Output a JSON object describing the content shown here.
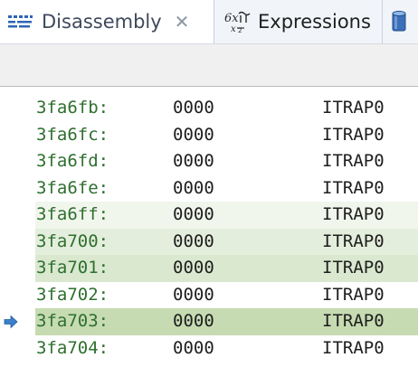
{
  "tabs": [
    {
      "label": "Disassembly",
      "close_symbol": "✕",
      "icon": "disassembly-icon",
      "active": true
    },
    {
      "label": "Expressions",
      "icon": "expressions-icon",
      "active": false
    },
    {
      "icon": "cylinder-icon",
      "active": false
    }
  ],
  "colors": {
    "address": "#2f6f2f",
    "highlight_faint": "#f1f6ed",
    "highlight_light": "#e4eedc",
    "highlight_medium": "#d9e8cf",
    "highlight_current": "#c6dbb1",
    "pc_marker": "#3a7fc9"
  },
  "disassembly": {
    "rows": [
      {
        "address": "3fa6fb:",
        "opcode": "0000",
        "mnemonic": "ITRAP0",
        "highlight": "none",
        "current": false
      },
      {
        "address": "3fa6fc:",
        "opcode": "0000",
        "mnemonic": "ITRAP0",
        "highlight": "none",
        "current": false
      },
      {
        "address": "3fa6fd:",
        "opcode": "0000",
        "mnemonic": "ITRAP0",
        "highlight": "none",
        "current": false
      },
      {
        "address": "3fa6fe:",
        "opcode": "0000",
        "mnemonic": "ITRAP0",
        "highlight": "none",
        "current": false
      },
      {
        "address": "3fa6ff:",
        "opcode": "0000",
        "mnemonic": "ITRAP0",
        "highlight": "faint",
        "current": false
      },
      {
        "address": "3fa700:",
        "opcode": "0000",
        "mnemonic": "ITRAP0",
        "highlight": "light",
        "current": false
      },
      {
        "address": "3fa701:",
        "opcode": "0000",
        "mnemonic": "ITRAP0",
        "highlight": "medium",
        "current": false
      },
      {
        "address": "3fa702:",
        "opcode": "0000",
        "mnemonic": "ITRAP0",
        "highlight": "none",
        "current": false
      },
      {
        "address": "3fa703:",
        "opcode": "0000",
        "mnemonic": "ITRAP0",
        "highlight": "current",
        "current": true
      },
      {
        "address": "3fa704:",
        "opcode": "0000",
        "mnemonic": "ITRAP0",
        "highlight": "none",
        "current": false
      }
    ]
  }
}
